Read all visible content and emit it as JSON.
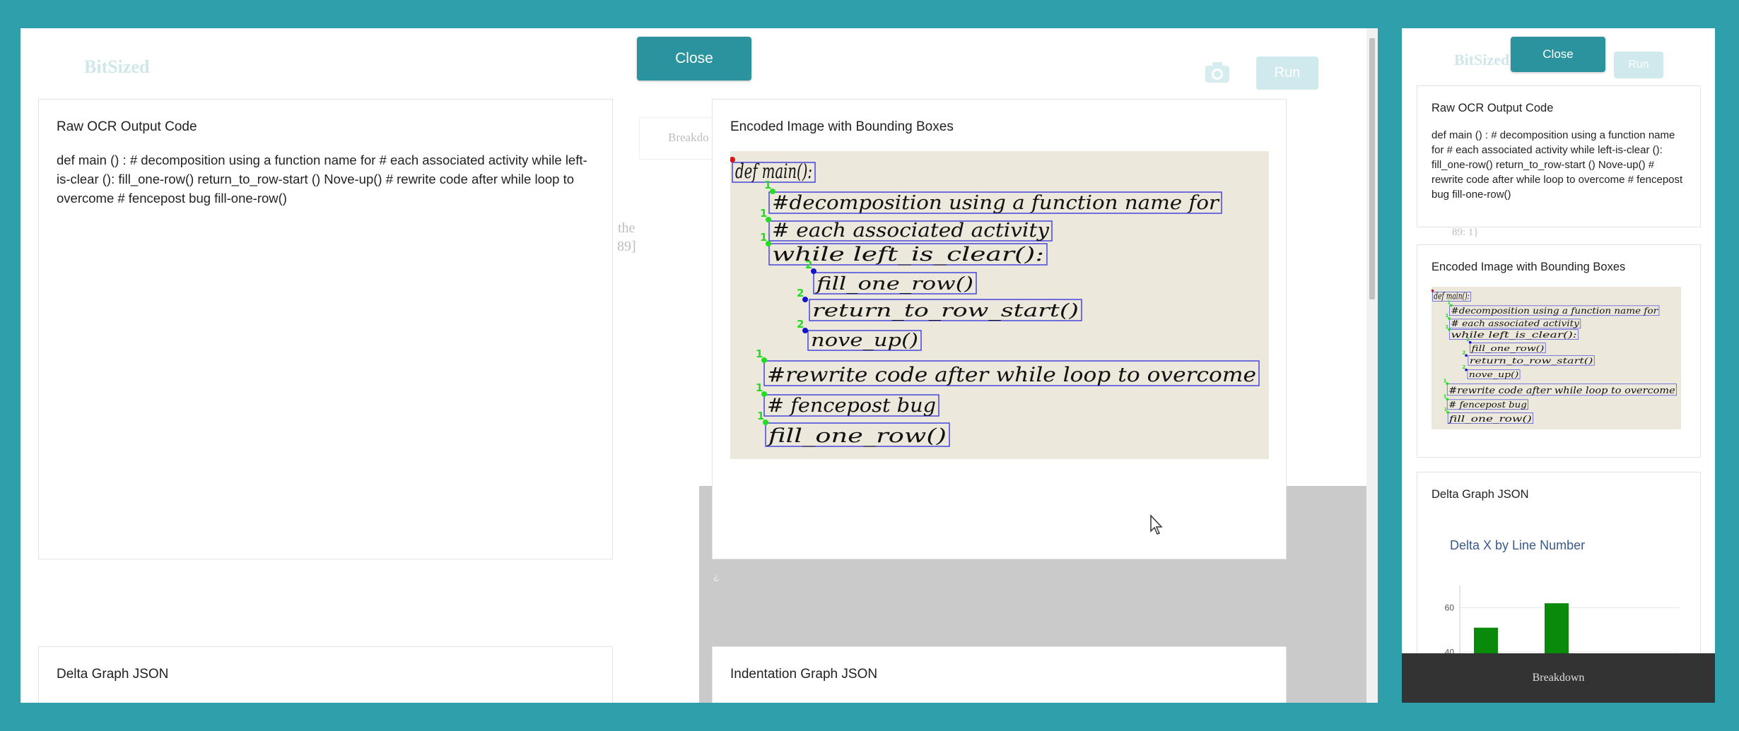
{
  "brand": "BitSized",
  "buttons": {
    "close": "Close",
    "run": "Run"
  },
  "cards": {
    "ocr_title": "Raw OCR Output Code",
    "ocr_text": "def main () : # decomposition using a function name for # each associated activity while left-is-clear (): fill_one-row() return_to_row-start () Nove-up() # rewrite code after while loop to overcome # fencepost bug fill-one-row()",
    "encoded_title": "Encoded Image with Bounding Boxes",
    "delta_title": "Delta Graph JSON",
    "indent_title": "Indentation Graph JSON"
  },
  "background_fragments": {
    "breakdown_partial": "Breakdo",
    "the": "the",
    "bracket": "89]",
    "side_fragment": "89: 1}",
    "small_mark": "¿"
  },
  "handwriting_lines": [
    "def main():",
    "#decomposition using a function name for",
    "# each associated activity",
    "while left_is_clear():",
    "fill_one_row()",
    "return_to_row_start()",
    "nove_up()",
    "#rewrite code after while loop to overcome",
    "# fencepost bug",
    "fill_one_row()"
  ],
  "indent_markers": [
    "1",
    "1",
    "1",
    "2",
    "2",
    "2",
    "1",
    "1",
    "1"
  ],
  "chart_data": {
    "type": "bar",
    "title": "Delta X by Line Number",
    "xlabel": "",
    "ylabel": "",
    "yticks": [
      40,
      60
    ],
    "ylim": [
      0,
      70
    ],
    "bar_color": "#0a8a0a",
    "values": [
      51,
      62
    ],
    "grid": true
  },
  "footer": {
    "label": "Breakdown"
  },
  "colors": {
    "teal_bg": "#2fa0ab",
    "button": "#2a939e",
    "bbox": "#3b3bdc",
    "marker_green": "#22dd22"
  }
}
